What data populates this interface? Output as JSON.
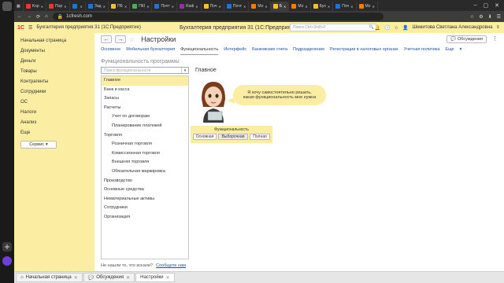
{
  "os": {
    "left_icons": [
      "windows-icon",
      "app-icon",
      "app-icon",
      "app-icon",
      "app-icon",
      "app-icon",
      "app-icon",
      "plus-icon",
      "assistant-icon"
    ]
  },
  "browser": {
    "tabs": [
      {
        "label": "Kop",
        "color": "#e53935"
      },
      {
        "label": "Пор",
        "color": "#e53935"
      },
      {
        "label": "",
        "color": "#1976d2"
      },
      {
        "label": "Зад",
        "color": "#1976d2"
      },
      {
        "label": "ПБ",
        "color": "#fbc02d"
      },
      {
        "label": "ПКІ",
        "color": "#4caf50"
      },
      {
        "label": "Почт",
        "color": "#1976d2"
      },
      {
        "label": "Radi",
        "color": "#9c27b0"
      },
      {
        "label": "Поч",
        "color": "#fbc02d"
      },
      {
        "label": "Почт",
        "color": "#1976d2"
      },
      {
        "label": "Mo",
        "color": "#f57c00"
      },
      {
        "label": "Б",
        "color": "#fbc02d",
        "active": true
      },
      {
        "label": "Мо",
        "color": "#f57c00"
      },
      {
        "label": "Бух",
        "color": "#fbc02d"
      },
      {
        "label": "Поч",
        "color": "#1976d2"
      },
      {
        "label": "Mo",
        "color": "#f57c00"
      }
    ],
    "url": "1cfresh.com",
    "title_icon": "home-icon"
  },
  "app_header": {
    "logo": "1С",
    "name": "Бухгалтерия предприятия 31 (1С:Предприятие)",
    "window_title": "Бухгалтерия предприятия 31 (1С:Предприятие)",
    "search_placeholder": "Поиск Ctrl+Shift+F",
    "user": "Шемитова Светлана Александровна"
  },
  "sidebar": {
    "items": [
      "Начальная страница",
      "Документы",
      "Деньги",
      "Товары",
      "Контрагенты",
      "Сотрудники",
      "ОС",
      "Налоги",
      "Анализ",
      "Еще"
    ],
    "service_button": "Сервис"
  },
  "page": {
    "title": "Настройки",
    "discussions_button": "Обсуждения",
    "more": "⋮",
    "tabs": [
      {
        "label": "Основное"
      },
      {
        "label": "Мобильная бухгалтерия"
      },
      {
        "label": "Функциональность",
        "active": true
      },
      {
        "label": "Интерфейс"
      },
      {
        "label": "Банковские счета"
      },
      {
        "label": "Подразделения"
      },
      {
        "label": "Регистрации в налоговых органах"
      },
      {
        "label": "Учетная политика"
      },
      {
        "label": "Еще"
      }
    ],
    "section_title": "Функциональность программы",
    "feature_search_placeholder": "Поиск функциональности",
    "tree": [
      {
        "label": "Главное",
        "level": 0,
        "selected": true
      },
      {
        "label": "Банк и касса",
        "level": 0
      },
      {
        "label": "Запасы",
        "level": 0
      },
      {
        "label": "Расчеты",
        "level": 0
      },
      {
        "label": "Учет по договорам",
        "level": 1
      },
      {
        "label": "Планирование платежей",
        "level": 1
      },
      {
        "label": "Торговля",
        "level": 0
      },
      {
        "label": "Розничная торговля",
        "level": 1
      },
      {
        "label": "Комиссионная торговля",
        "level": 1
      },
      {
        "label": "Внешняя торговля",
        "level": 1
      },
      {
        "label": "Обязательная маркировка",
        "level": 1
      },
      {
        "label": "Производство",
        "level": 0
      },
      {
        "label": "Основные средства",
        "level": 0
      },
      {
        "label": "Нематериальные активы",
        "level": 0
      },
      {
        "label": "Сотрудники",
        "level": 0
      },
      {
        "label": "Организация",
        "level": 0
      }
    ],
    "not_found_text": "Не нашли то, что искали?",
    "report_link": "Сообщите нам",
    "panel_title": "Главное",
    "bubble_line1": "Я хочу самостоятельно решать,",
    "bubble_line2": "какая функциональность мне нужна",
    "functionality_label": "Функциональность",
    "functionality_options": [
      {
        "label": "Основная"
      },
      {
        "label": "Выборочная",
        "selected": true
      },
      {
        "label": "Полная"
      }
    ]
  },
  "bottom_tabs": [
    {
      "label": "Начальная страница",
      "icon": "home-icon"
    },
    {
      "label": "Обсуждения",
      "icon": "chat-icon"
    },
    {
      "label": "Настройки",
      "active": true
    }
  ],
  "colors": {
    "accent_yellow": "#fbeea2",
    "link_blue": "#1b4f9c",
    "logo_red": "#d01f2e"
  }
}
